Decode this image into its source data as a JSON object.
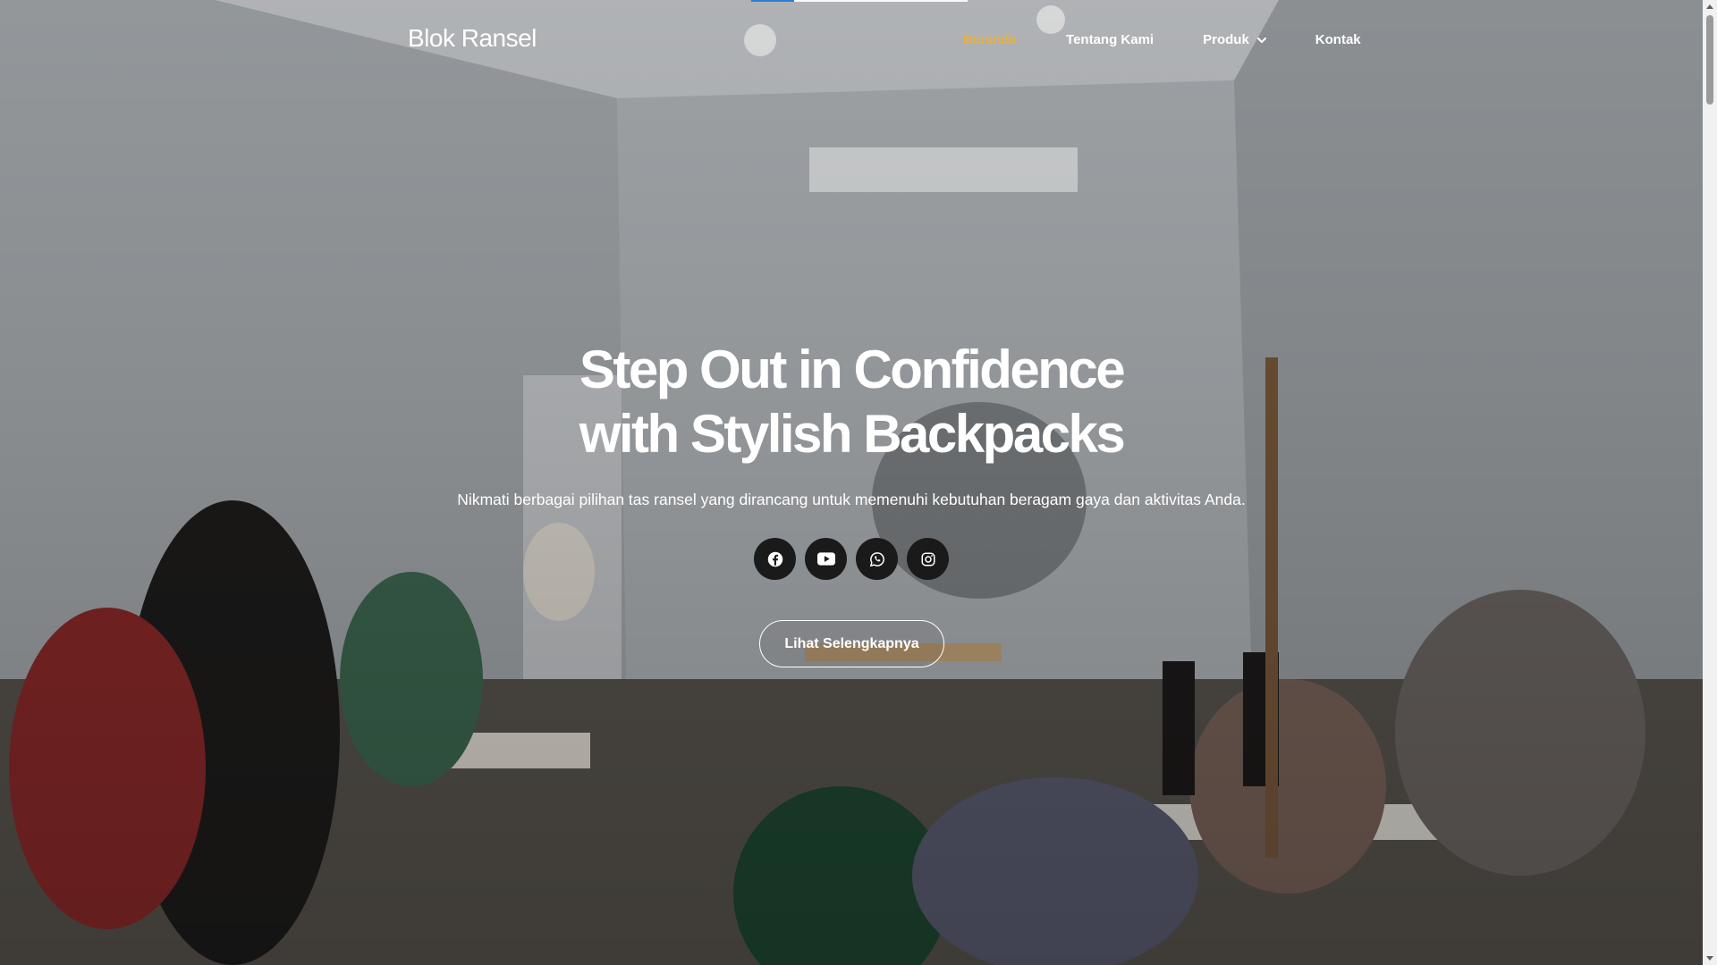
{
  "header": {
    "logo": "Blok Ransel",
    "nav": [
      {
        "label": "Beranda",
        "active": true
      },
      {
        "label": "Tentang Kami",
        "active": false
      },
      {
        "label": "Produk",
        "active": false,
        "has_dropdown": true
      },
      {
        "label": "Kontak",
        "active": false
      }
    ],
    "active_color": "#e9b13b"
  },
  "hero": {
    "title_line1": "Step Out in Confidence",
    "title_line2": "with Stylish Backpacks",
    "subtitle": "Nikmati berbagai pilihan tas ransel yang dirancang untuk memenuhi kebutuhan beragam gaya dan aktivitas Anda.",
    "social": [
      {
        "icon": "facebook-icon"
      },
      {
        "icon": "youtube-icon"
      },
      {
        "icon": "whatsapp-icon"
      },
      {
        "icon": "instagram-icon"
      }
    ],
    "cta_label": "Lihat Selengkapnya",
    "background": "photo of workers sewing backpacks in a workshop"
  }
}
